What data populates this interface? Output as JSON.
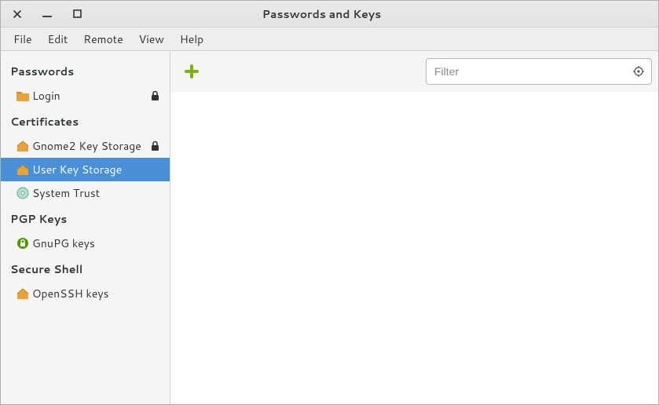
{
  "window": {
    "title": "Passwords and Keys"
  },
  "menubar": {
    "file": "File",
    "edit": "Edit",
    "remote": "Remote",
    "view": "View",
    "help": "Help"
  },
  "sidebar": {
    "sections": {
      "passwords": {
        "header": "Passwords",
        "items": [
          {
            "label": "Login",
            "icon": "folder-icon",
            "locked": true
          }
        ]
      },
      "certificates": {
        "header": "Certificates",
        "items": [
          {
            "label": "Gnome2 Key Storage",
            "icon": "home-icon",
            "locked": true
          },
          {
            "label": "User Key Storage",
            "icon": "home-icon",
            "locked": false,
            "selected": true
          },
          {
            "label": "System Trust",
            "icon": "disc-icon",
            "locked": false
          }
        ]
      },
      "pgp": {
        "header": "PGP Keys",
        "items": [
          {
            "label": "GnuPG keys",
            "icon": "circle-lock-icon",
            "locked": false
          }
        ]
      },
      "ssh": {
        "header": "Secure Shell",
        "items": [
          {
            "label": "OpenSSH keys",
            "icon": "home-icon",
            "locked": false
          }
        ]
      }
    }
  },
  "toolbar": {
    "filter_placeholder": "Filter"
  }
}
